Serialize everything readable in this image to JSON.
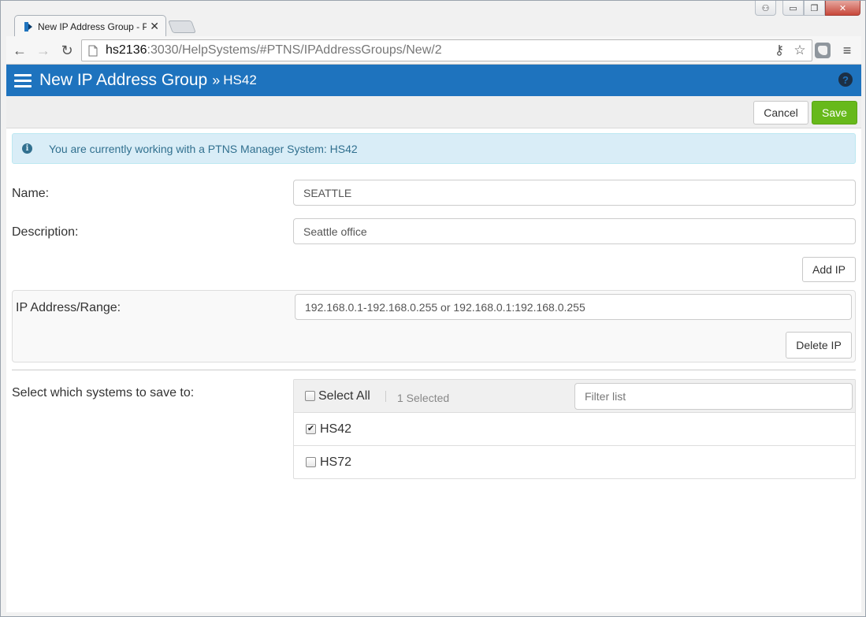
{
  "browser": {
    "tab_title": "New IP Address Group - P",
    "tab_close": "✕",
    "url_host": "hs2136",
    "url_rest": ":3030/HelpSystems/#PTNS/IPAddressGroups/New/2",
    "back_glyph": "←",
    "forward_glyph": "→",
    "reload_glyph": "↻",
    "key_glyph": "⚷",
    "star_glyph": "☆",
    "menu_glyph": "≡",
    "min_glyph": "▭",
    "max_glyph": "❐",
    "close_glyph": "✕",
    "profile_glyph": "⚇"
  },
  "header": {
    "title": "New IP Address Group",
    "separator": "»",
    "system": "HS42",
    "help_glyph": "?"
  },
  "actions": {
    "cancel_label": "Cancel",
    "save_label": "Save"
  },
  "alert": {
    "icon_glyph": "i",
    "text": "You are currently working with a PTNS Manager System: HS42"
  },
  "form": {
    "name_label": "Name:",
    "name_value": "SEATTLE",
    "description_label": "Description:",
    "description_value": "Seattle office",
    "add_ip_label": "Add IP",
    "ip_label": "IP Address/Range:",
    "ip_placeholder": "192.168.0.1-192.168.0.255 or 192.168.0.1:192.168.0.255",
    "delete_ip_label": "Delete IP"
  },
  "systems": {
    "label": "Select which systems to save to:",
    "select_all_label": "Select All",
    "selected_count": "1 Selected",
    "filter_placeholder": "Filter list",
    "items": [
      {
        "name": "HS42",
        "checked": true,
        "mark": "✔"
      },
      {
        "name": "HS72",
        "checked": false,
        "mark": ""
      }
    ]
  },
  "colors": {
    "appbar": "#1e73be",
    "save_button": "#67b91b",
    "alert_bg": "#d9edf7",
    "alert_text": "#31708f"
  }
}
